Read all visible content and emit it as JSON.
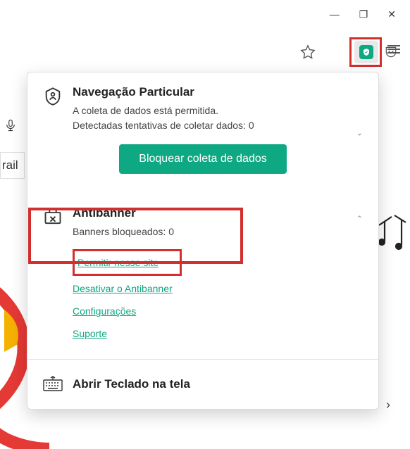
{
  "window": {
    "minimize": "—",
    "maximize": "❐",
    "close": "✕"
  },
  "bg": {
    "rail_text": "rail"
  },
  "popup": {
    "private": {
      "title": "Navegação Particular",
      "line1": "A coleta de dados está permitida.",
      "line2": "Detectadas tentativas de coletar dados: 0",
      "button": "Bloquear coleta de dados"
    },
    "antibanner": {
      "title": "Antibanner",
      "sub": "Banners bloqueados: 0",
      "links": {
        "allow": "Permitir nesse site",
        "disable": "Desativar o Antibanner",
        "settings": "Configurações",
        "support": "Suporte"
      }
    },
    "keyboard": {
      "title": "Abrir Teclado na tela"
    }
  }
}
